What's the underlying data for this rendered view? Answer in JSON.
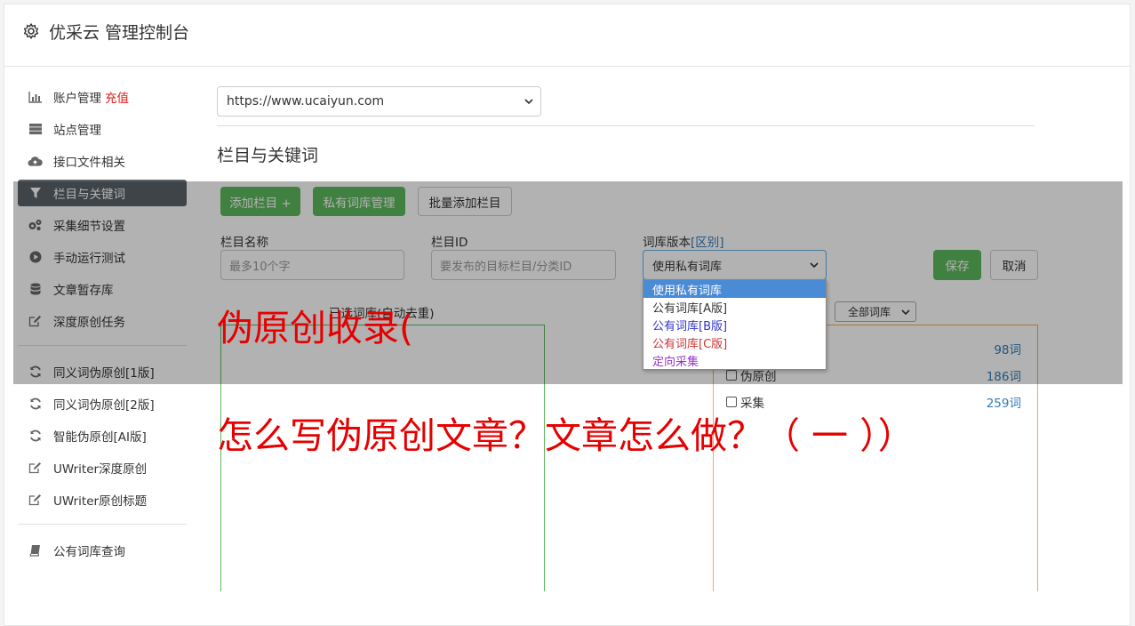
{
  "header": {
    "title": "优采云 管理控制台"
  },
  "sidebar": {
    "group1": [
      {
        "label": "账户管理",
        "extra": "充值",
        "icon": "bar-chart-icon"
      },
      {
        "label": "站点管理",
        "icon": "server-icon"
      },
      {
        "label": "接口文件相关",
        "icon": "cloud-upload-icon"
      },
      {
        "label": "栏目与关键词",
        "icon": "filter-icon",
        "active": true
      },
      {
        "label": "采集细节设置",
        "icon": "gears-icon"
      },
      {
        "label": "手动运行测试",
        "icon": "play-circle-icon"
      },
      {
        "label": "文章暂存库",
        "icon": "database-icon"
      },
      {
        "label": "深度原创任务",
        "icon": "edit-icon"
      }
    ],
    "group2": [
      {
        "label": "同义词伪原创[1版]",
        "icon": "refresh-icon"
      },
      {
        "label": "同义词伪原创[2版]",
        "icon": "refresh-icon"
      },
      {
        "label": "智能伪原创[AI版]",
        "icon": "refresh-icon"
      },
      {
        "label": "UWriter深度原创",
        "icon": "edit-icon"
      },
      {
        "label": "UWriter原创标题",
        "icon": "edit-icon"
      }
    ],
    "group3": [
      {
        "label": "公有词库查询",
        "icon": "book-icon"
      }
    ]
  },
  "main": {
    "site_select": "https://www.ucaiyun.com",
    "section_title": "栏目与关键词",
    "buttons": {
      "add_column": "添加栏目 +",
      "private_lib": "私有词库管理",
      "batch_add": "批量添加栏目",
      "save": "保存",
      "cancel": "取消"
    },
    "form": {
      "name_label": "栏目名称",
      "name_placeholder": "最多10个字",
      "id_label": "栏目ID",
      "id_placeholder": "要发布的目标栏目/分类ID",
      "version_label": "词库版本",
      "version_link": "[区别]",
      "version_value": "使用私有词库"
    },
    "dropdown_options": [
      {
        "label": "使用私有词库",
        "color": "#ffffff"
      },
      {
        "label": "公有词库[A版]",
        "color": "#333333"
      },
      {
        "label": "公有词库[B版]",
        "color": "#3333cc"
      },
      {
        "label": "公有词库[C版]",
        "color": "#cc3333"
      },
      {
        "label": "定向采集",
        "color": "#9933cc"
      }
    ],
    "left_pane_title": "已选词库(自动去重)",
    "filter_select": "全部词库",
    "right_rows": [
      {
        "label": "",
        "count": "98词"
      },
      {
        "label": "伪原创",
        "count": "186词"
      },
      {
        "label": "采集",
        "count": "259词"
      }
    ]
  },
  "captions": {
    "line1": "伪原创收录(",
    "line2": "怎么写伪原创文章？文章怎么做？（ 一 ））"
  }
}
